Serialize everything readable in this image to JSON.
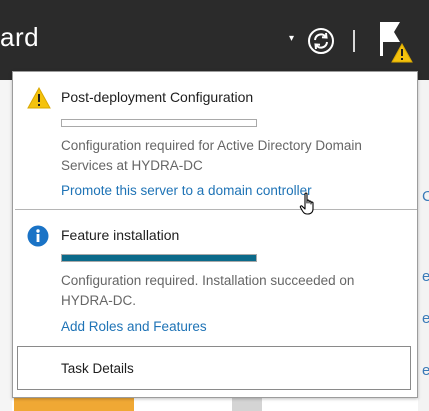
{
  "header": {
    "title": "ard",
    "dropdown_glyph": "▾",
    "refresh_icon": "refresh-icon",
    "flag_icon": "notifications-flag-warning-icon",
    "background": "#2b2b2b"
  },
  "right_strip": [
    "C",
    "e",
    "e",
    "e"
  ],
  "notifications": [
    {
      "icon": "warning-icon",
      "title": "Post-deployment Configuration",
      "progress": 0,
      "description": "Configuration required for Active Directory Domain Services at HYDRA-DC",
      "link": "Promote this server to a domain controller"
    },
    {
      "icon": "info-icon",
      "title": "Feature installation",
      "progress": 1,
      "description": "Configuration required. Installation succeeded on HYDRA-DC.",
      "link": "Add Roles and Features"
    }
  ],
  "task_details": {
    "label": "Task Details"
  },
  "colors": {
    "link": "#1e73b6",
    "progress_fill": "#0b6a8a",
    "warning": "#f4c20d",
    "info": "#1a73c6"
  }
}
